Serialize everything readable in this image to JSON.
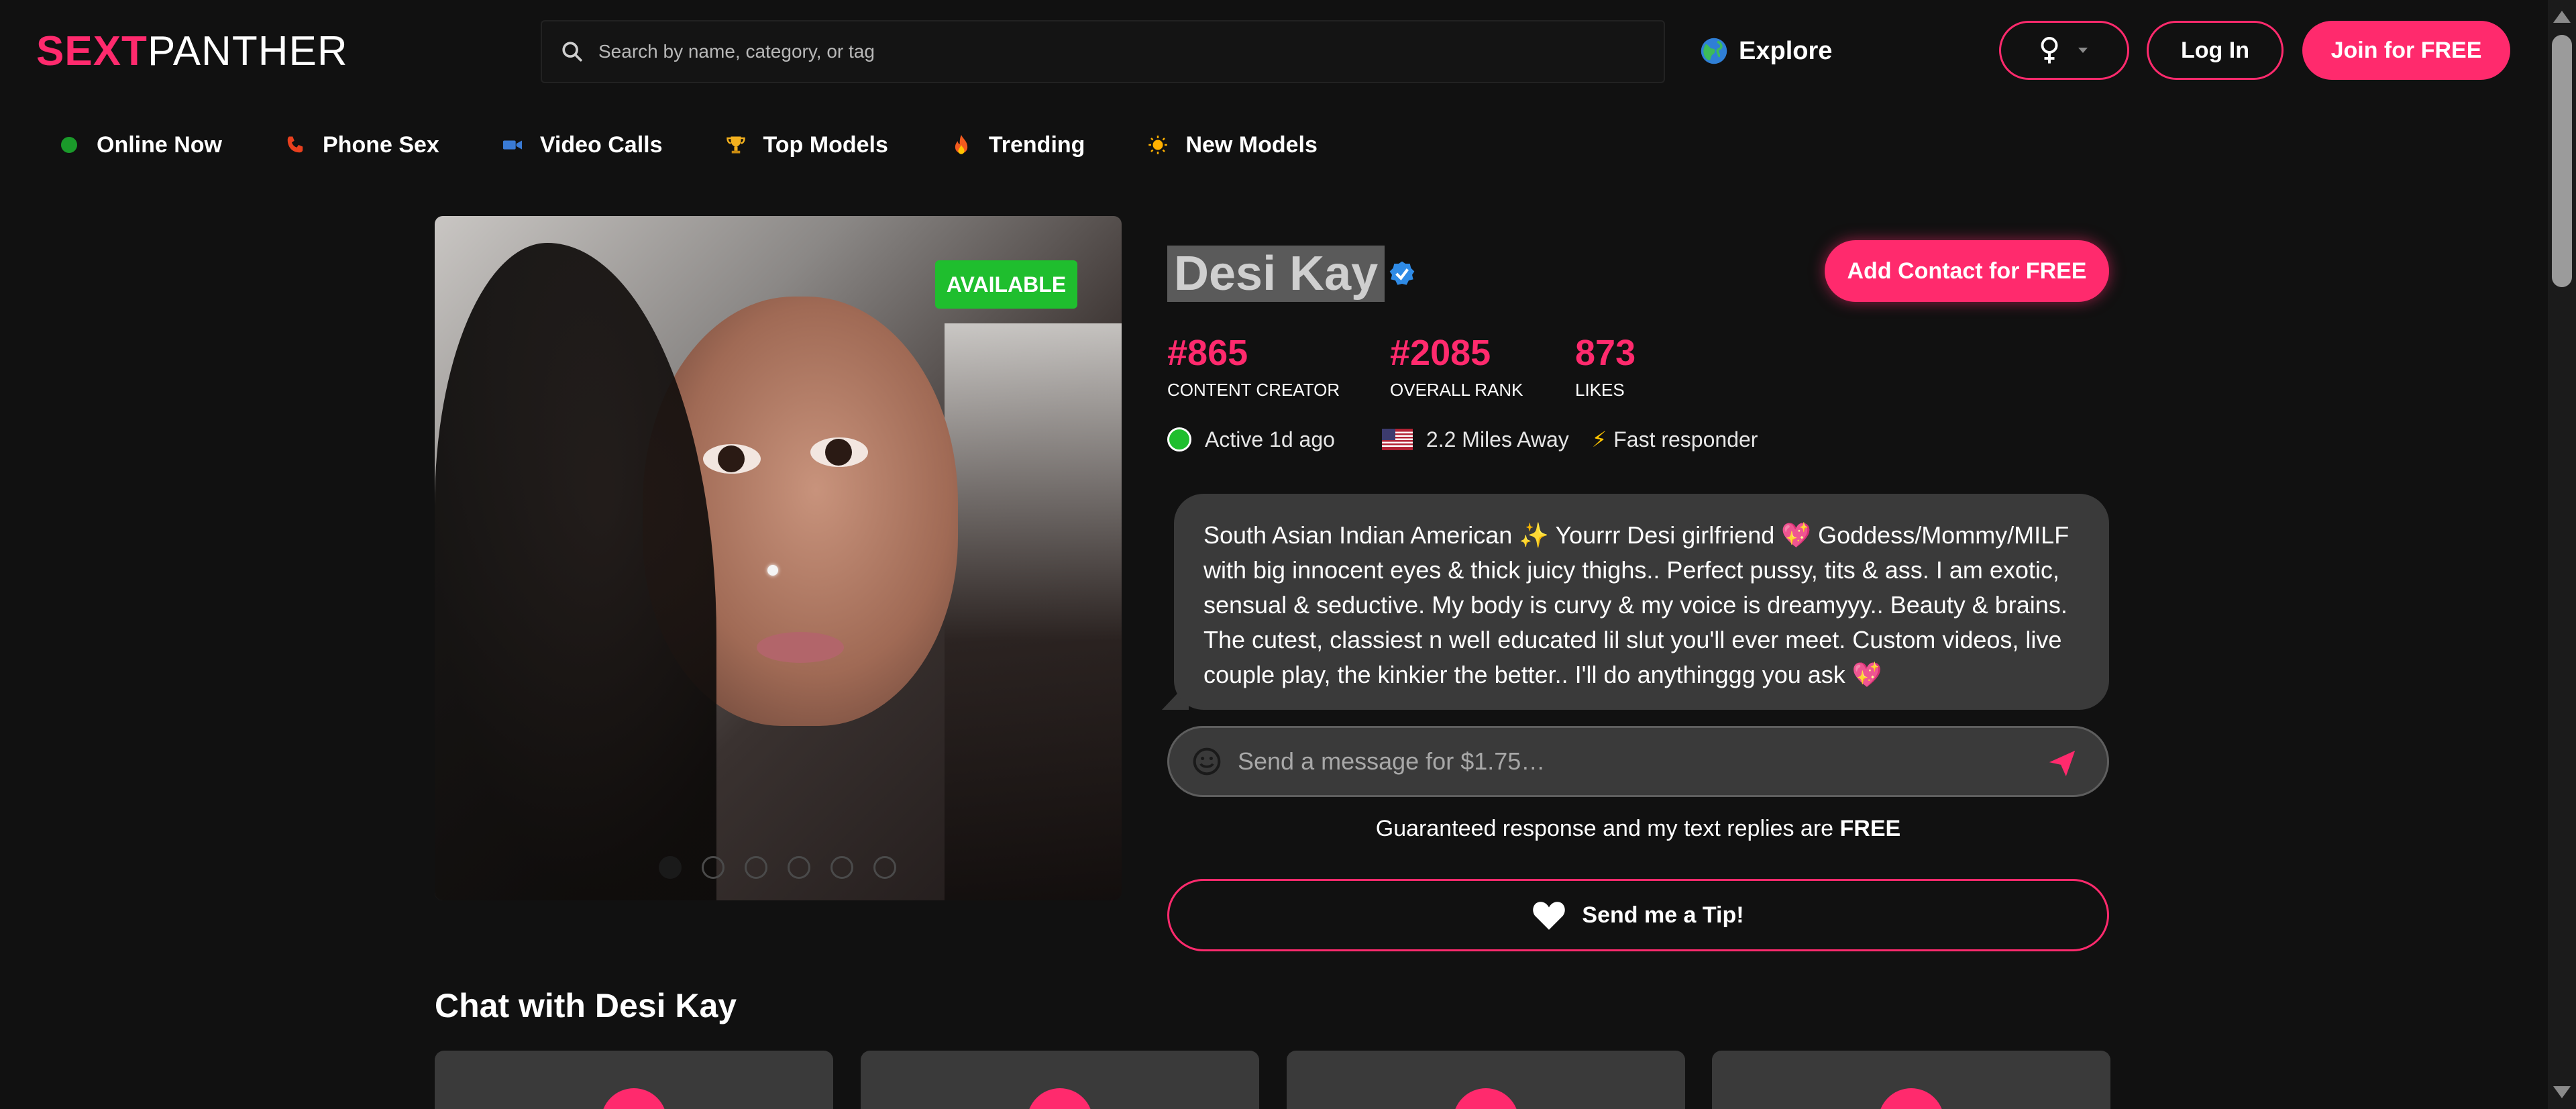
{
  "header": {
    "logo_part1": "SEXT",
    "logo_part2": "PANTHER",
    "search_placeholder": "Search by name, category, or tag",
    "explore_label": "Explore",
    "login_label": "Log In",
    "join_label": "Join for FREE"
  },
  "nav": {
    "items": [
      {
        "label": "Online Now",
        "icon": "green-dot-icon"
      },
      {
        "label": "Phone Sex",
        "icon": "phone-icon"
      },
      {
        "label": "Video Calls",
        "icon": "video-camera-icon"
      },
      {
        "label": "Top Models",
        "icon": "trophy-icon"
      },
      {
        "label": "Trending",
        "icon": "fire-icon"
      },
      {
        "label": "New Models",
        "icon": "sun-icon"
      }
    ]
  },
  "profile": {
    "available_badge": "AVAILABLE",
    "name": "Desi Kay",
    "add_contact_label": "Add Contact for FREE",
    "stats": [
      {
        "value": "#865",
        "label": "CONTENT CREATOR"
      },
      {
        "value": "#2085",
        "label": "OVERALL RANK"
      },
      {
        "value": "873",
        "label": "LIKES"
      }
    ],
    "active_text": "Active 1d ago",
    "distance_text": "2.2 Miles Away",
    "responder_text": "Fast responder",
    "bio": "South Asian Indian American ✨ Yourrr Desi girlfriend 💖 Goddess/Mommy/MILF with big innocent eyes & thick juicy thighs.. Perfect pussy, tits & ass. I am exotic, sensual & seductive. My body is curvy & my voice is dreamyyy.. Beauty & brains. The cutest, classiest n well educated lil slut you'll ever meet. Custom videos, live couple play, the kinkier the better.. I'll do anythinggg you ask 💖",
    "message_placeholder": "Send a message for $1.75…",
    "guarantee_text": "Guaranteed response and my text replies are ",
    "guarantee_bold": "FREE",
    "tip_label": "Send me a Tip!",
    "photo_count": 6,
    "active_photo": 1
  },
  "chat": {
    "heading": "Chat with Desi Kay"
  },
  "colors": {
    "accent": "#ff2a6d",
    "available": "#1fbe2e",
    "background": "#111111",
    "card": "#3a3a3a"
  }
}
